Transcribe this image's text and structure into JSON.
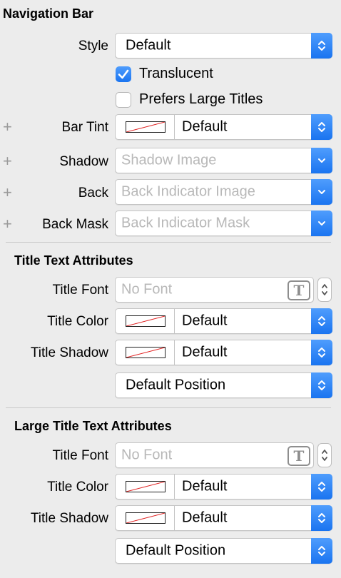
{
  "navigation_bar": {
    "title": "Navigation Bar",
    "style": {
      "label": "Style",
      "value": "Default"
    },
    "translucent": {
      "label": "Translucent",
      "checked": true
    },
    "prefers_large_titles": {
      "label": "Prefers Large Titles",
      "checked": false
    },
    "bar_tint": {
      "label": "Bar Tint",
      "value": "Default"
    },
    "shadow": {
      "label": "Shadow",
      "placeholder": "Shadow Image"
    },
    "back": {
      "label": "Back",
      "placeholder": "Back Indicator Image"
    },
    "back_mask": {
      "label": "Back Mask",
      "placeholder": "Back Indicator Mask"
    },
    "plus_symbol": "+"
  },
  "title_text_attributes": {
    "title": "Title Text Attributes",
    "title_font": {
      "label": "Title Font",
      "placeholder": "No Font"
    },
    "title_color": {
      "label": "Title Color",
      "value": "Default"
    },
    "title_shadow": {
      "label": "Title Shadow",
      "value": "Default"
    },
    "shadow_position": "Default Position"
  },
  "large_title_text_attributes": {
    "title": "Large Title Text Attributes",
    "title_font": {
      "label": "Title Font",
      "placeholder": "No Font"
    },
    "title_color": {
      "label": "Title Color",
      "value": "Default"
    },
    "title_shadow": {
      "label": "Title Shadow",
      "value": "Default"
    },
    "shadow_position": "Default Position"
  },
  "font_icon_glyph": "T",
  "colors": {
    "accent": "#1a74f0",
    "background": "#ececec",
    "placeholder": "#b8b8b8"
  },
  "icons": [
    "updown-chevron-icon",
    "down-chevron-icon",
    "checkbox-checked-icon",
    "plus-icon",
    "font-picker-icon",
    "stepper-icon",
    "color-swatch-icon"
  ]
}
